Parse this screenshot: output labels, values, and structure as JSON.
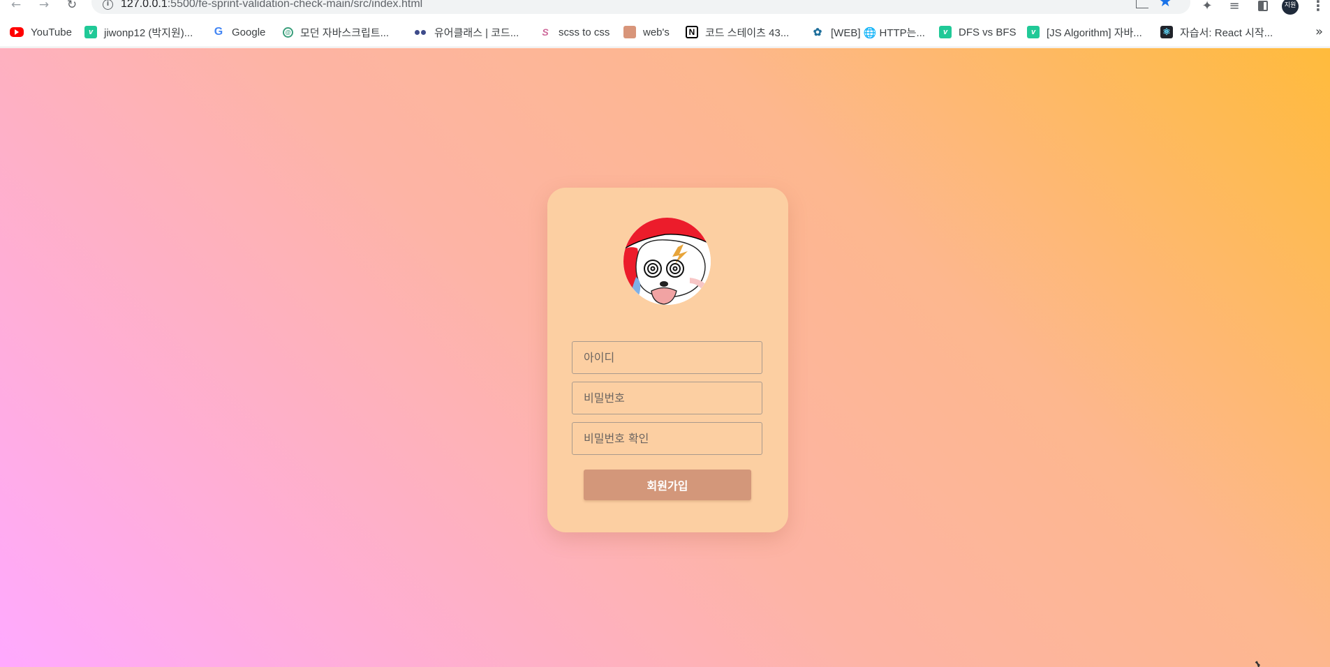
{
  "browser": {
    "url_host": "127.0.0.1",
    "url_rest": ":5500/fe-sprint-validation-check-main/src/index.html",
    "profile_label": "지원",
    "accent_color": "#1a73e8"
  },
  "bookmarks": [
    {
      "label": "YouTube",
      "icon": "youtube-icon"
    },
    {
      "label": "jiwonp12 (박지원)...",
      "icon": "velog-icon"
    },
    {
      "label": "Google",
      "icon": "google-icon"
    },
    {
      "label": "모던 자바스크립트...",
      "icon": "modern-js-icon"
    },
    {
      "label": "유어클래스 | 코드...",
      "icon": "urclass-icon"
    },
    {
      "label": "scss to css",
      "icon": "sass-icon"
    },
    {
      "label": "web's",
      "icon": "bookmark-image-icon"
    },
    {
      "label": "코드 스테이츠 43...",
      "icon": "notion-icon"
    },
    {
      "label": "[WEB] 🌐 HTTP는...",
      "icon": "bird-icon"
    },
    {
      "label": "DFS vs BFS",
      "icon": "velog-icon"
    },
    {
      "label": "[JS Algorithm] 자바...",
      "icon": "velog-icon"
    },
    {
      "label": "자습서: React 시작...",
      "icon": "react-icon"
    }
  ],
  "form": {
    "username_placeholder": "아이디",
    "password_placeholder": "비밀번호",
    "password_confirm_placeholder": "비밀번호 확인",
    "submit_label": "회원가입"
  },
  "colors": {
    "card": "#fccfa2",
    "button": "#d3977a",
    "gradient_top_right": "#ffbb3c",
    "gradient_bottom_left": "#ffa9ff"
  }
}
